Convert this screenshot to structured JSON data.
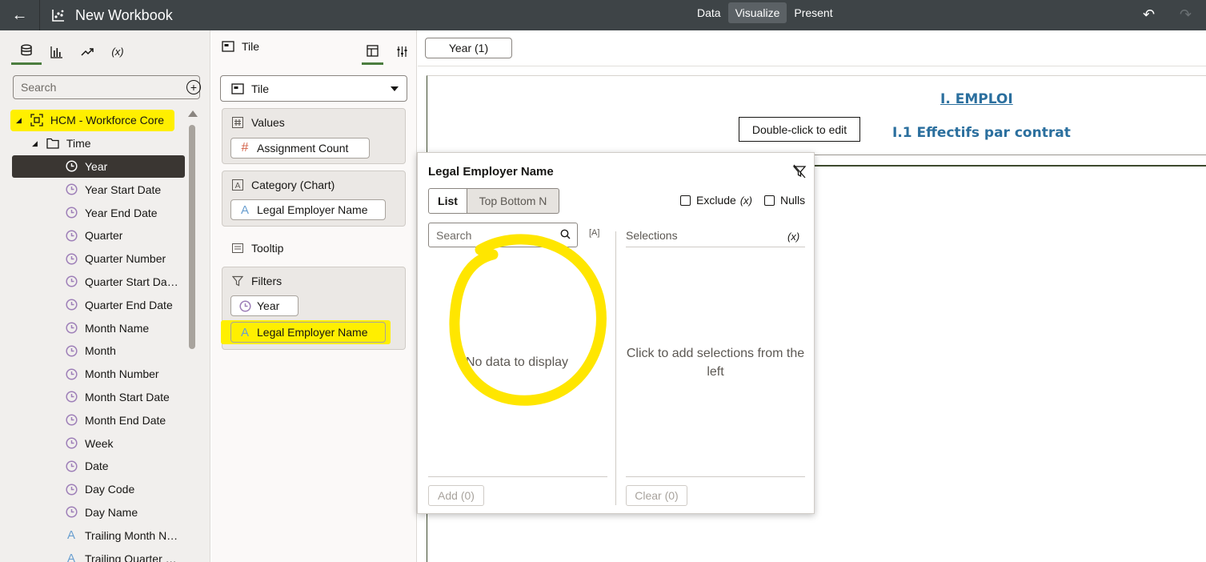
{
  "topbar": {
    "title": "New Workbook",
    "tabs": [
      {
        "label": "Data",
        "active": false
      },
      {
        "label": "Visualize",
        "active": true
      },
      {
        "label": "Present",
        "active": false
      }
    ]
  },
  "data_panel": {
    "search_placeholder": "Search",
    "dataset": "HCM - Workforce Core",
    "folder": "Time",
    "columns": [
      {
        "label": "Year",
        "type": "time",
        "selected": true
      },
      {
        "label": "Year Start Date",
        "type": "time"
      },
      {
        "label": "Year End Date",
        "type": "time"
      },
      {
        "label": "Quarter",
        "type": "time"
      },
      {
        "label": "Quarter Number",
        "type": "time"
      },
      {
        "label": "Quarter Start Da…",
        "type": "time"
      },
      {
        "label": "Quarter End Date",
        "type": "time"
      },
      {
        "label": "Month Name",
        "type": "time"
      },
      {
        "label": "Month",
        "type": "time"
      },
      {
        "label": "Month Number",
        "type": "time"
      },
      {
        "label": "Month Start Date",
        "type": "time"
      },
      {
        "label": "Month End Date",
        "type": "time"
      },
      {
        "label": "Week",
        "type": "time"
      },
      {
        "label": "Date",
        "type": "time"
      },
      {
        "label": "Day Code",
        "type": "time"
      },
      {
        "label": "Day Name",
        "type": "time"
      },
      {
        "label": "Trailing Month N…",
        "type": "text"
      },
      {
        "label": "Trailing Quarter …",
        "type": "text"
      }
    ]
  },
  "grammar": {
    "header": "Tile",
    "viz_type": "Tile",
    "values_title": "Values",
    "values_item": "Assignment Count",
    "category_title": "Category (Chart)",
    "category_item": "Legal Employer Name",
    "tooltip_title": "Tooltip",
    "filters_title": "Filters",
    "filter_items": [
      "Year",
      "Legal Employer Name"
    ]
  },
  "canvas": {
    "filter_chip": "Year (1)",
    "heading1": "I. EMPLOI",
    "edit_tip": "Double-click to edit",
    "heading2": "I.1 Effectifs par contrat"
  },
  "filter_popup": {
    "title": "Legal Employer Name",
    "mode_list": "List",
    "mode_topbottom": "Top Bottom N",
    "exclude_label": "Exclude",
    "exclude_x": "(x)",
    "nulls_label": "Nulls",
    "search_placeholder": "Search",
    "no_data": "No data to display",
    "selections_label": "Selections",
    "selections_x": "(x)",
    "selections_hint": "Click to add selections from the left",
    "add_button": "Add (0)",
    "clear_button": "Clear (0)"
  },
  "colors": {
    "topbar": "#3e4447",
    "accent_green": "#4b7d3f",
    "heading_blue": "#2b6f9e",
    "highlight": "#ffef00",
    "time_icon": "#9e7fb8",
    "text_icon": "#6a9fd0",
    "measure_icon": "#d4634a"
  }
}
